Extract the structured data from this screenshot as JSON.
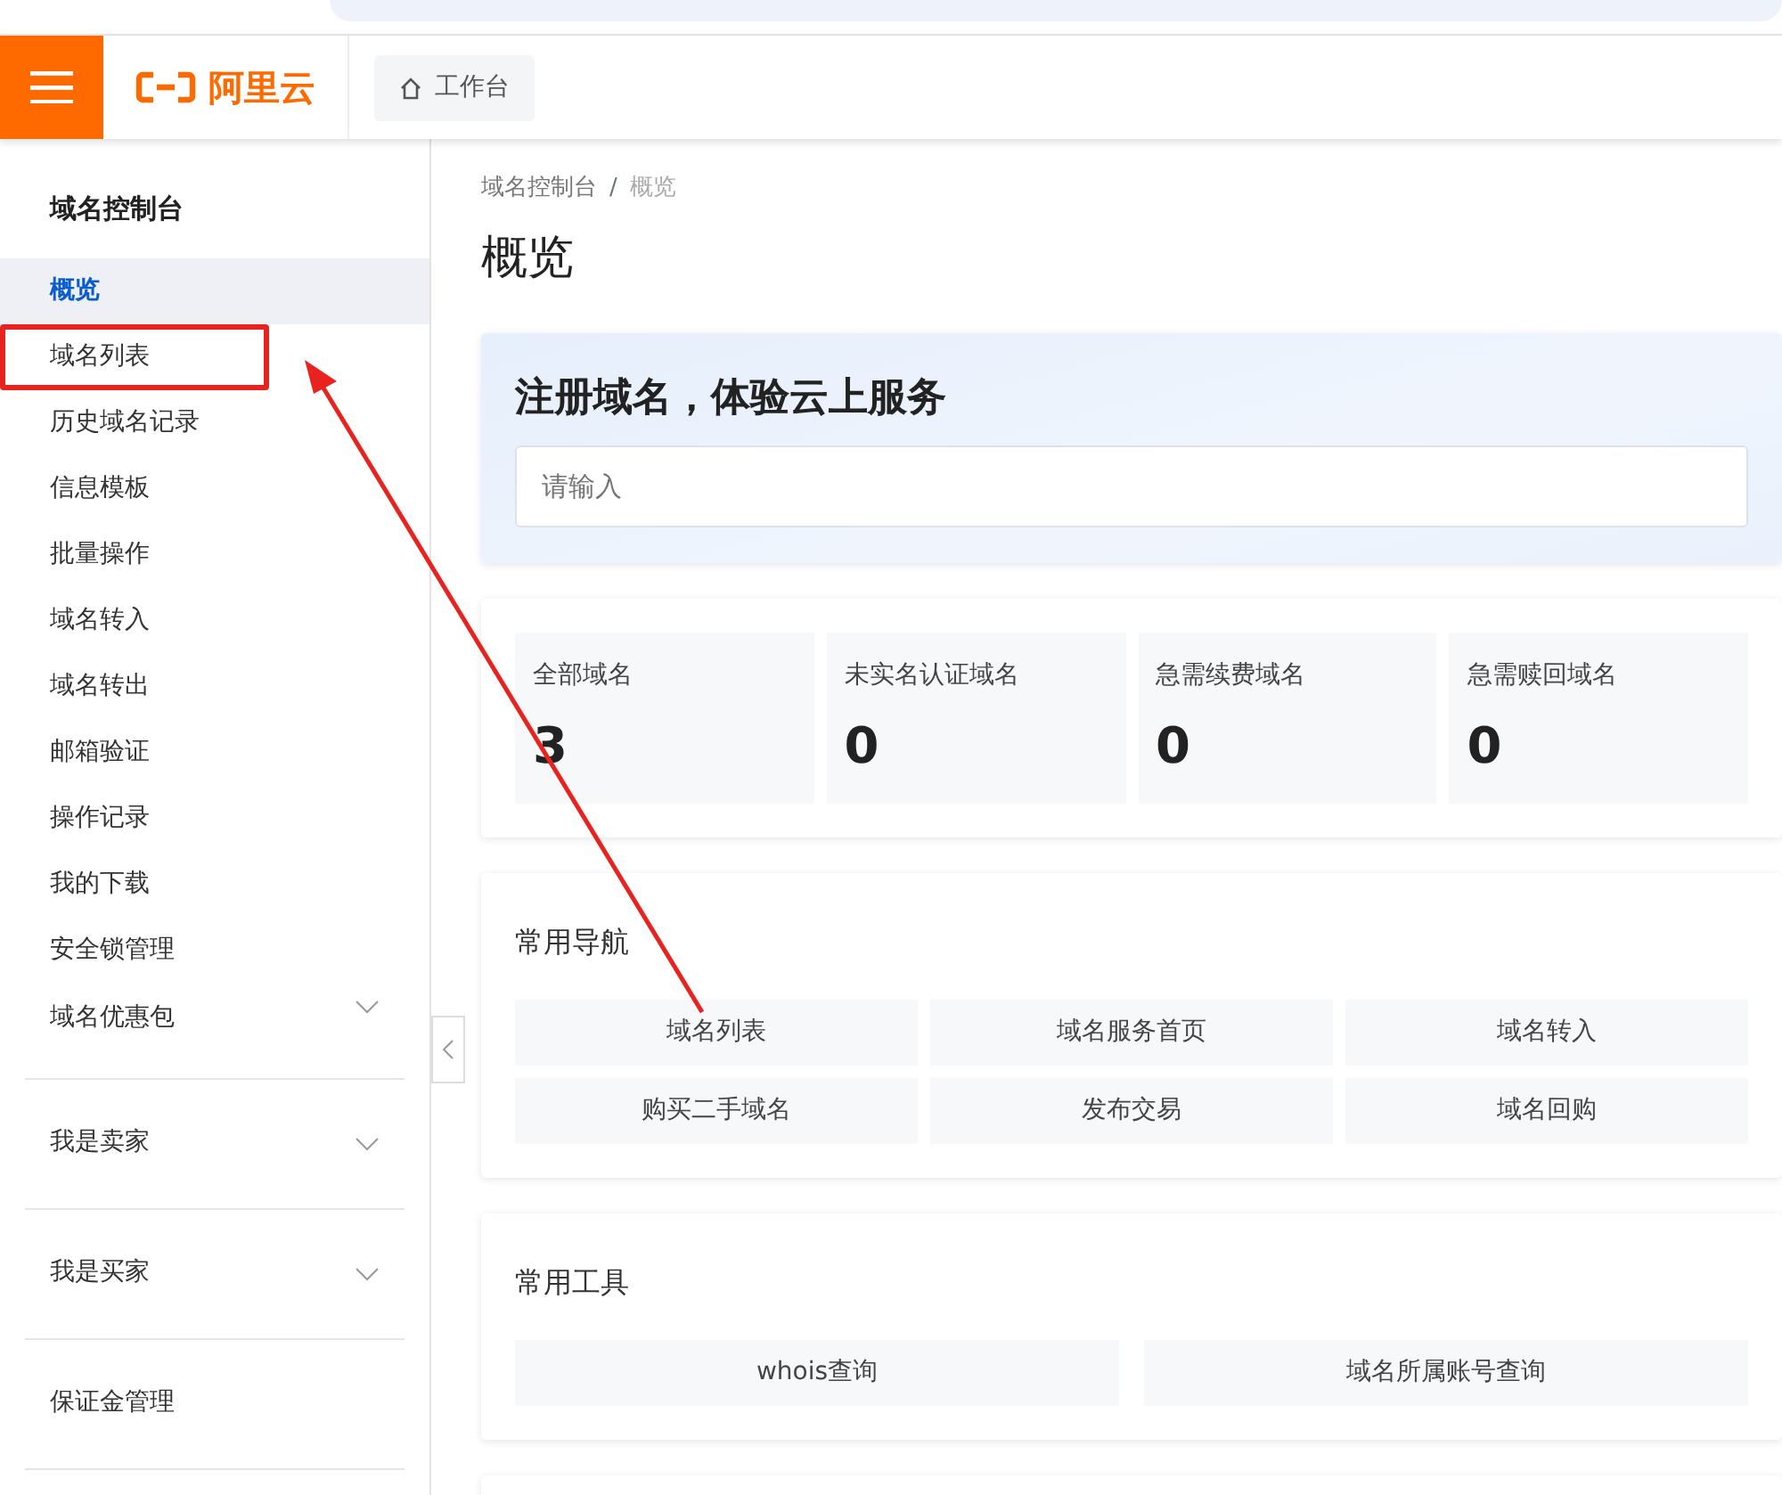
{
  "header": {
    "logo": "阿里云",
    "workbench_button": "工作台"
  },
  "sidebar": {
    "title": "域名控制台",
    "items": [
      {
        "kind": "link",
        "label": "概览",
        "selected": true
      },
      {
        "kind": "link",
        "label": "域名列表",
        "selected": false,
        "highlighted": true
      },
      {
        "kind": "link",
        "label": "历史域名记录",
        "selected": false
      },
      {
        "kind": "link",
        "label": "信息模板",
        "selected": false
      },
      {
        "kind": "link",
        "label": "批量操作",
        "selected": false
      },
      {
        "kind": "link",
        "label": "域名转入",
        "selected": false
      },
      {
        "kind": "link",
        "label": "域名转出",
        "selected": false
      },
      {
        "kind": "link",
        "label": "邮箱验证",
        "selected": false
      },
      {
        "kind": "link",
        "label": "操作记录",
        "selected": false
      },
      {
        "kind": "link",
        "label": "我的下载",
        "selected": false
      },
      {
        "kind": "link",
        "label": "安全锁管理",
        "selected": false
      },
      {
        "kind": "group",
        "label": "域名优惠包",
        "selected": false,
        "expanded": false
      },
      {
        "kind": "group",
        "label": "我是卖家",
        "selected": false,
        "expanded": false
      },
      {
        "kind": "group",
        "label": "我是买家",
        "selected": false,
        "expanded": false
      },
      {
        "kind": "section",
        "label": "保证金管理",
        "selected": false
      }
    ]
  },
  "breadcrumb": {
    "separator": "/",
    "items": [
      "域名控制台",
      "概览"
    ]
  },
  "page_title": "概览",
  "register": {
    "title": "注册域名，体验云上服务",
    "search": {
      "placeholder": "请输入"
    }
  },
  "stats": [
    {
      "label": "全部域名",
      "value": "3"
    },
    {
      "label": "未实名认证域名",
      "value": "0"
    },
    {
      "label": "急需续费域名",
      "value": "0"
    },
    {
      "label": "急需赎回域名",
      "value": "0"
    }
  ],
  "quick_nav": {
    "title": "常用导航",
    "links": [
      "域名列表",
      "域名服务首页",
      "域名转入",
      "购买二手域名",
      "发布交易",
      "域名回购"
    ]
  },
  "tools": {
    "title": "常用工具",
    "links": [
      "whois查询",
      "域名所属账号查询"
    ]
  }
}
